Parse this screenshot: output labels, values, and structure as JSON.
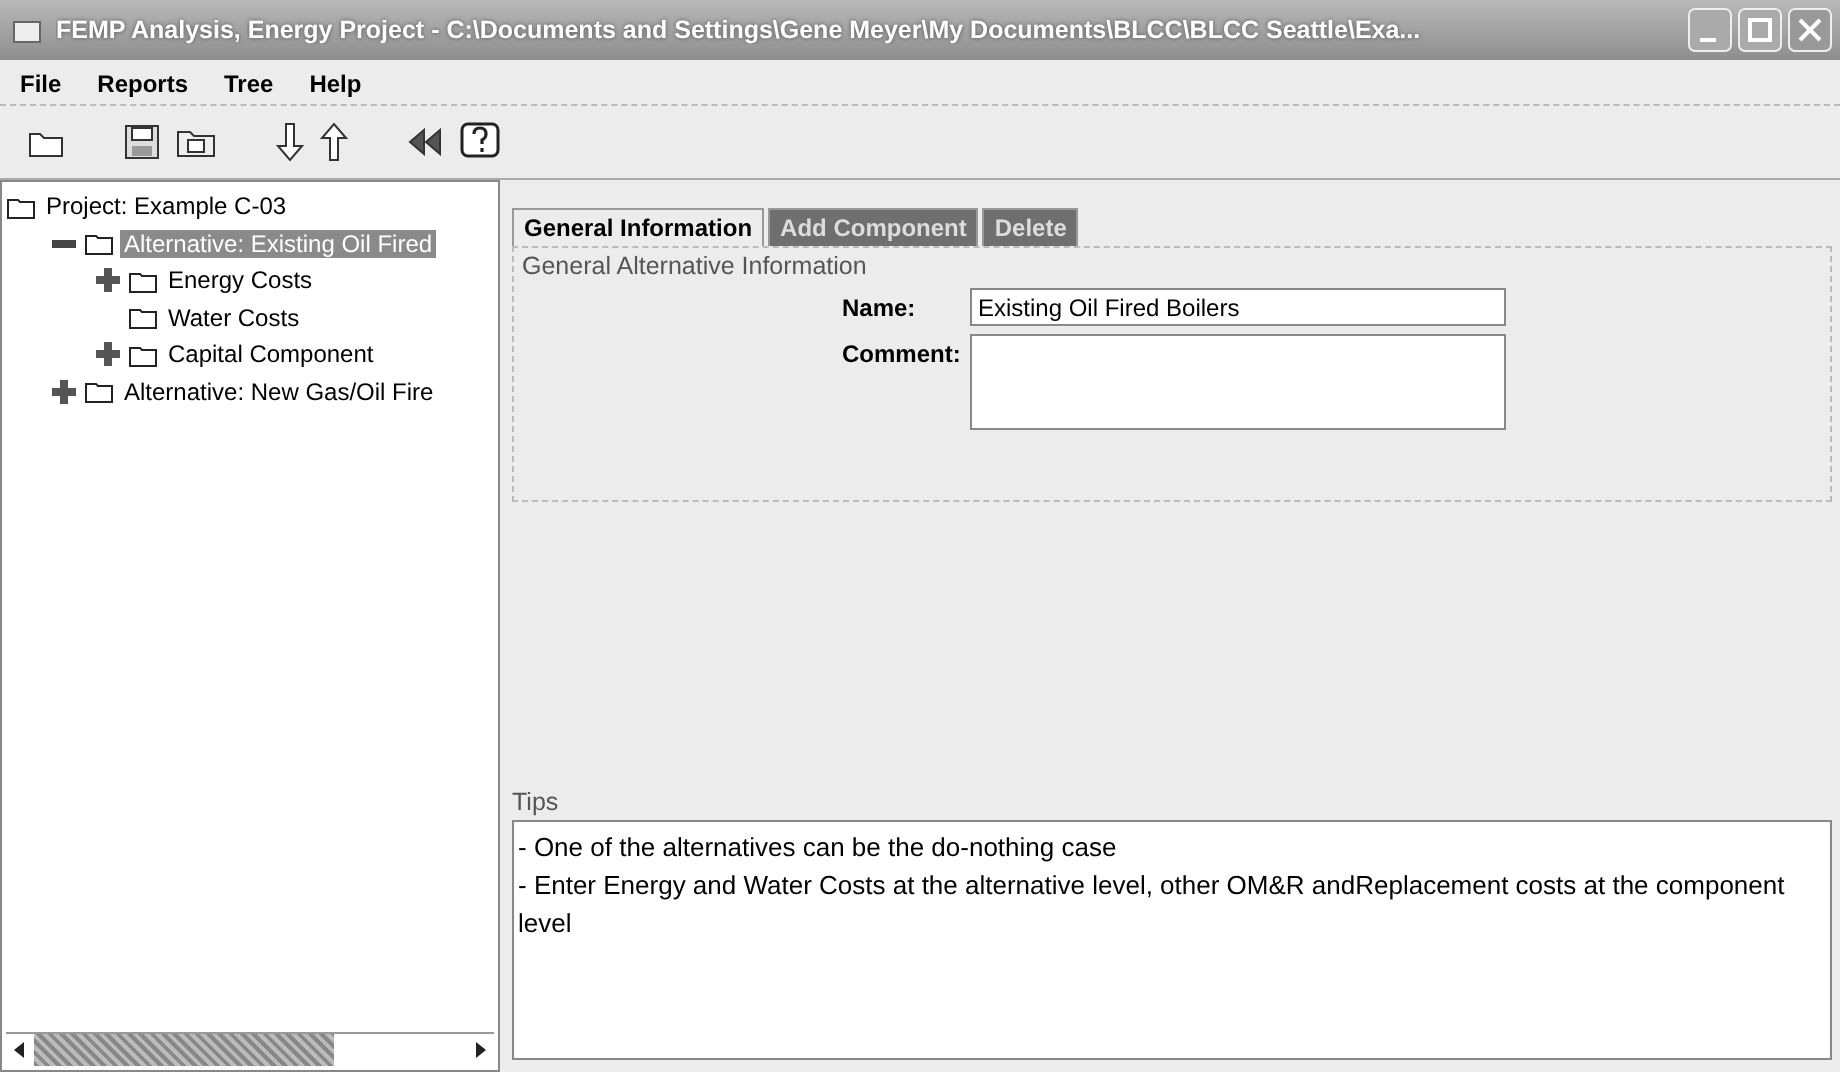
{
  "window": {
    "title": "FEMP Analysis, Energy Project - C:\\Documents and Settings\\Gene Meyer\\My Documents\\BLCC\\BLCC Seattle\\Exa..."
  },
  "menu": [
    "File",
    "Reports",
    "Tree",
    "Help"
  ],
  "tree": [
    {
      "label": "Project: Example C-03",
      "selected": false,
      "children": [
        {
          "label": "Alternative: Existing Oil Fired",
          "selected": true,
          "expanded": true,
          "children": [
            {
              "label": "Energy Costs",
              "selected": false,
              "expanded": false
            },
            {
              "label": "Water Costs",
              "selected": false
            },
            {
              "label": "Capital Component",
              "selected": false,
              "expanded": false
            }
          ]
        },
        {
          "label": "Alternative: New Gas/Oil Fire",
          "selected": false,
          "expanded": false
        }
      ]
    }
  ],
  "tabs": [
    {
      "label": "General Information",
      "selected": true
    },
    {
      "label": "Add Component",
      "selected": false
    },
    {
      "label": "Delete",
      "selected": false
    }
  ],
  "group": {
    "title": "General Alternative Information",
    "fields": [
      {
        "kind": "text",
        "label": "Name:",
        "value": "Existing Oil Fired Boilers"
      },
      {
        "kind": "area",
        "label": "Comment:"
      }
    ]
  },
  "tips": {
    "title": "Tips",
    "lines": [
      "- One of the alternatives can be the do-nothing case",
      "- Enter Energy and Water Costs at the alternative level, other OM&R andReplacement costs at the component level"
    ]
  }
}
